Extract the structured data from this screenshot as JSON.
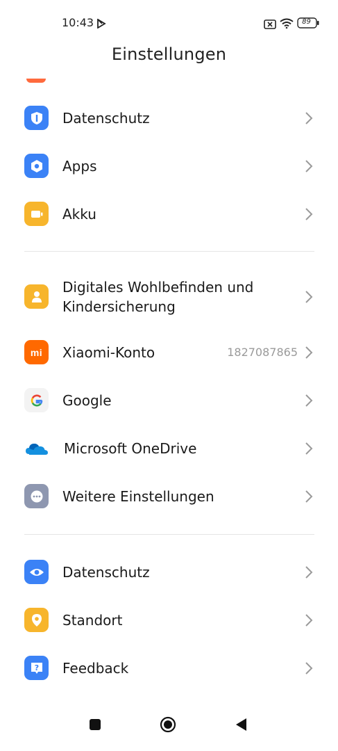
{
  "status_bar": {
    "time": "10:43",
    "battery": "89",
    "icons": [
      "play-store-icon",
      "sim-no-signal-icon",
      "wifi-icon",
      "battery-icon"
    ]
  },
  "header": {
    "title": "Einstellungen"
  },
  "groups": [
    {
      "items": [
        {
          "label": "Datenschutz",
          "icon": "shield-icon",
          "color": "#3b82f6"
        },
        {
          "label": "Apps",
          "icon": "hexagon-gear-icon",
          "color": "#3b82f6"
        },
        {
          "label": "Akku",
          "icon": "battery-icon",
          "color": "#f7b52c"
        }
      ]
    },
    {
      "items": [
        {
          "label": "Digitales Wohlbefinden und Kindersicherung",
          "icon": "person-icon",
          "color": "#f7b52c"
        },
        {
          "label": "Xiaomi-Konto",
          "icon": "mi-logo-icon",
          "color": "#ff6900",
          "value": "1827087865"
        },
        {
          "label": "Google",
          "icon": "google-icon",
          "color": "#f1f1f1"
        },
        {
          "label": "Microsoft OneDrive",
          "icon": "onedrive-cloud-icon",
          "color": "#0f78d4"
        },
        {
          "label": "Weitere Einstellungen",
          "icon": "more-dots-icon",
          "color": "#8e97b0"
        }
      ]
    },
    {
      "items": [
        {
          "label": "Datenschutz",
          "icon": "eye-icon",
          "color": "#3b82f6"
        },
        {
          "label": "Standort",
          "icon": "location-pin-icon",
          "color": "#f7b52c"
        },
        {
          "label": "Feedback",
          "icon": "feedback-question-icon",
          "color": "#3b82f6"
        }
      ]
    }
  ],
  "navigation_bar": {
    "buttons": [
      "recents-button",
      "home-button",
      "back-button"
    ]
  }
}
